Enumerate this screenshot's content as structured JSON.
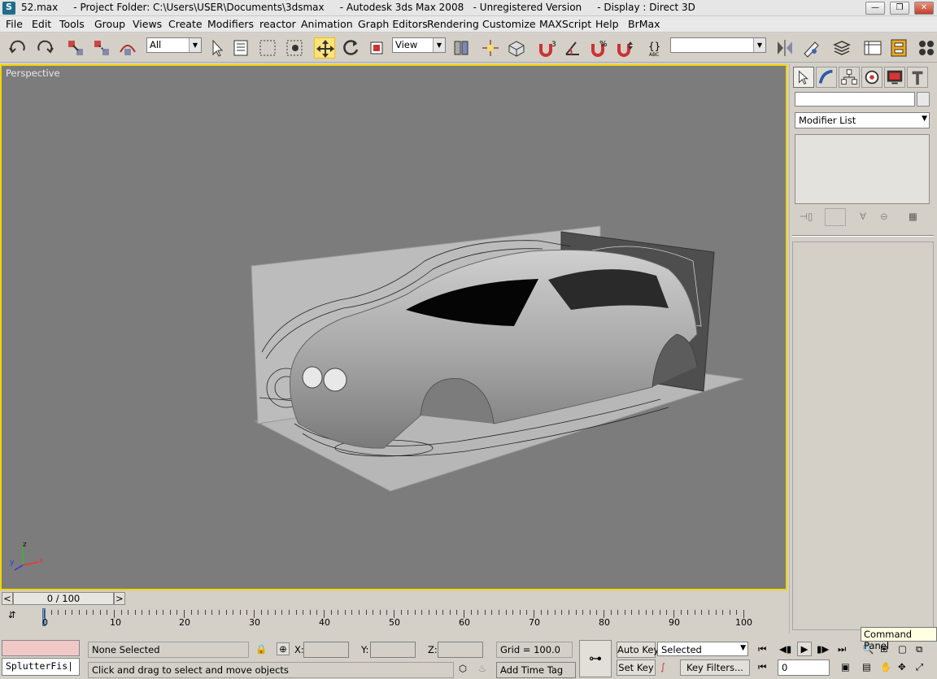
{
  "window": {
    "title": "52.max     - Project Folder: C:\\Users\\USER\\Documents\\3dsmax     - Autodesk 3ds Max 2008   - Unregistered Version     - Display : Direct 3D"
  },
  "menu": [
    "File",
    "Edit",
    "Tools",
    "Group",
    "Views",
    "Create",
    "Modifiers",
    "reactor",
    "Animation",
    "Graph Editors",
    "Rendering",
    "Customize",
    "MAXScript",
    "Help",
    "BrMax"
  ],
  "toolbar": {
    "selection_filter": "All",
    "reference_coord": "View",
    "named_selection": ""
  },
  "viewport": {
    "label": "Perspective",
    "axis": {
      "z": "z",
      "y": "y",
      "x": "x"
    }
  },
  "command_panel": {
    "name_field": "",
    "modifier_list": "Modifier List",
    "tooltip": "Command Panel"
  },
  "timeslider": {
    "frame": "0 / 100",
    "prev": "<",
    "next": ">"
  },
  "trackbar": {
    "ticks": [
      "0",
      "10",
      "20",
      "30",
      "40",
      "50",
      "60",
      "70",
      "80",
      "90",
      "100"
    ]
  },
  "status": {
    "maxscript": "SplutterFis|",
    "selection": "None Selected",
    "prompt": "Click and drag to select and move objects",
    "x_label": "X:",
    "y_label": "Y:",
    "z_label": "Z:",
    "x": "",
    "y": "",
    "z": "",
    "grid": "Grid = 100.0",
    "add_time_tag": "Add Time Tag",
    "auto_key": "Auto Key",
    "set_key": "Set Key",
    "key_mode": "Selected",
    "key_filters": "Key Filters...",
    "current_frame": "0"
  }
}
